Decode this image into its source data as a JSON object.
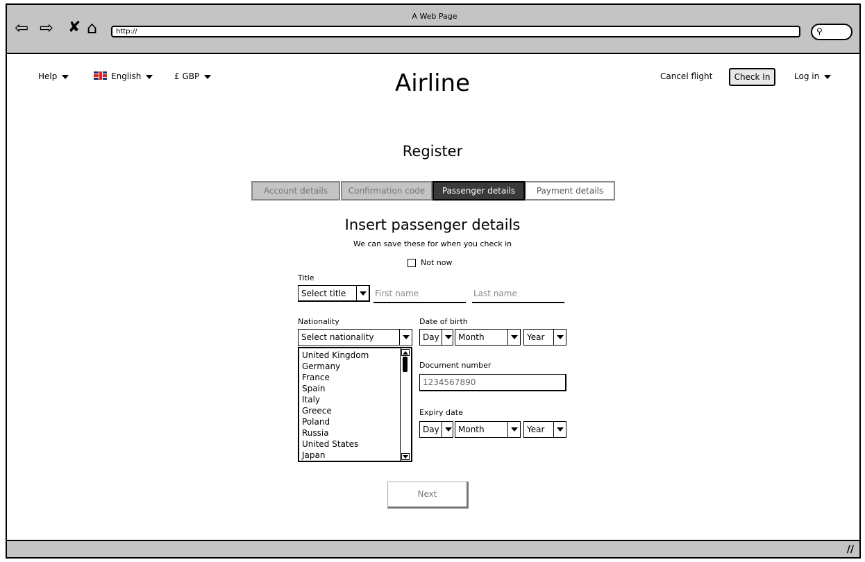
{
  "browser": {
    "window_title": "A Web Page",
    "url": "http://"
  },
  "header": {
    "help_label": "Help",
    "language_label": "English",
    "currency_label": "£ GBP",
    "logo_text": "Airline",
    "cancel_flight_label": "Cancel flight",
    "check_in_label": "Check In",
    "login_label": "Log in"
  },
  "register": {
    "title": "Register",
    "steps": [
      {
        "label": "Account details",
        "state": "done"
      },
      {
        "label": "Confirmation code",
        "state": "done"
      },
      {
        "label": "Passenger details",
        "state": "active"
      },
      {
        "label": "Payment details",
        "state": "todo"
      }
    ]
  },
  "form": {
    "heading": "Insert passenger details",
    "subheading": "We can save these for when you check in",
    "not_now_label": "Not now",
    "title_label": "Title",
    "title_select": "Select title",
    "first_name_placeholder": "First name",
    "last_name_placeholder": "Last name",
    "nationality_label": "Nationality",
    "nationality_select": "Select nationality",
    "nationality_options": [
      "United Kingdom",
      "Germany",
      "France",
      "Spain",
      "Italy",
      "Greece",
      "Poland",
      "Russia",
      "United States",
      "Japan"
    ],
    "dob_label": "Date of birth",
    "day_label": "Day",
    "month_label": "Month",
    "year_label": "Year",
    "document_label": "Document number",
    "document_value": "1234567890",
    "expiry_label": "Expiry date",
    "next_label": "Next"
  }
}
